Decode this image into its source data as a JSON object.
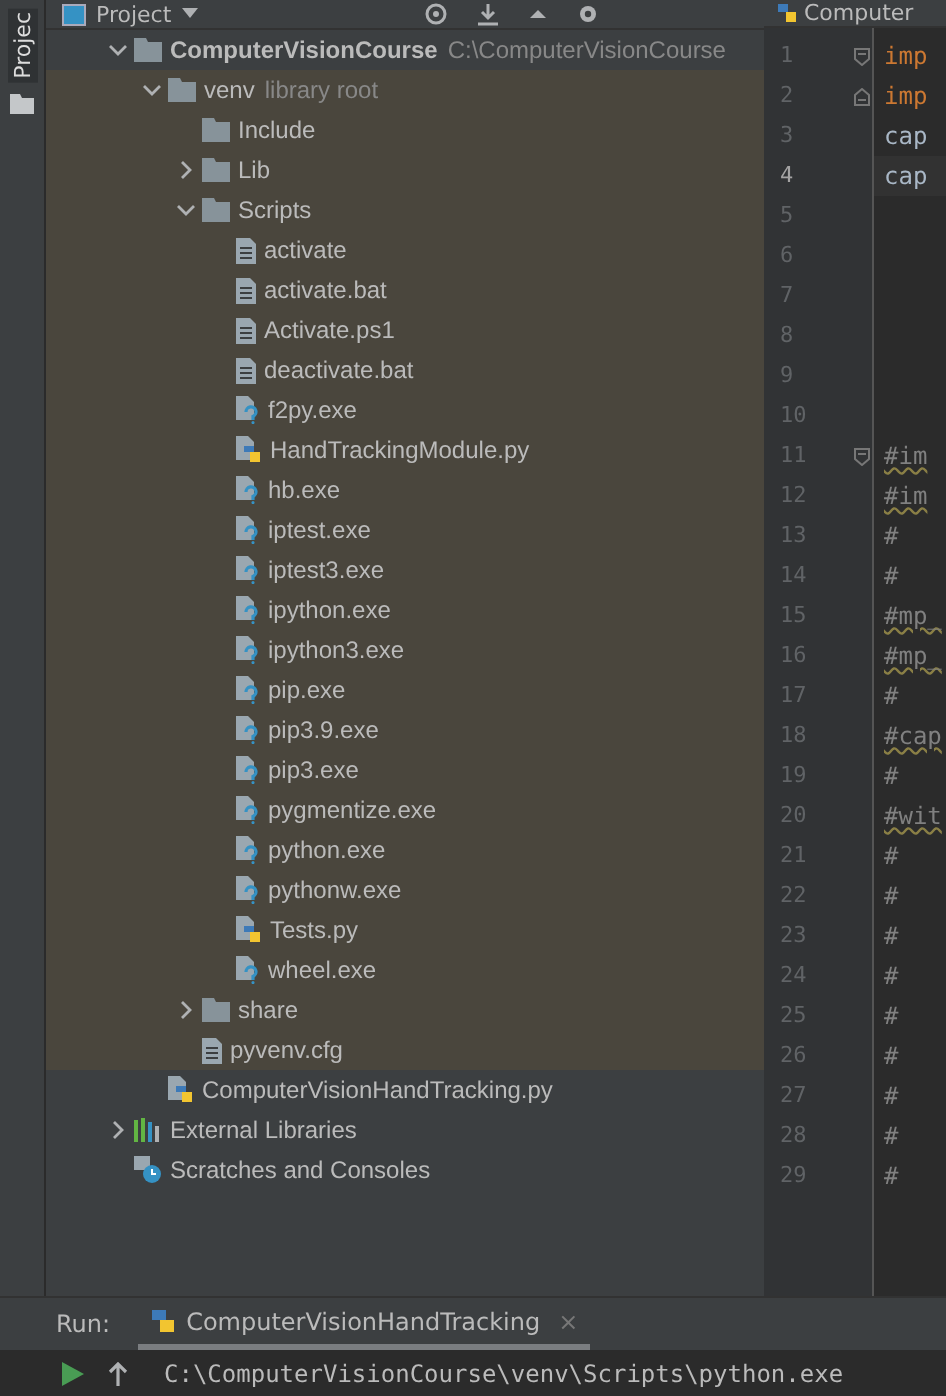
{
  "stripe": {
    "label": "Projec"
  },
  "project_header": {
    "title": "Project"
  },
  "tree": [
    {
      "name": "ComputerVisionCourse",
      "kind": "folder",
      "bold": true,
      "hint": "C:\\ComputerVisionCourse",
      "expanded": true,
      "children": [
        {
          "name": "venv",
          "kind": "folder",
          "hint": "library root",
          "library": true,
          "expanded": true,
          "children": [
            {
              "name": "Include",
              "kind": "folder"
            },
            {
              "name": "Lib",
              "kind": "folder",
              "expanded": false
            },
            {
              "name": "Scripts",
              "kind": "folder",
              "expanded": true,
              "children": [
                {
                  "name": "activate",
                  "kind": "text"
                },
                {
                  "name": "activate.bat",
                  "kind": "text"
                },
                {
                  "name": "Activate.ps1",
                  "kind": "text"
                },
                {
                  "name": "deactivate.bat",
                  "kind": "text"
                },
                {
                  "name": "f2py.exe",
                  "kind": "exe"
                },
                {
                  "name": "HandTrackingModule.py",
                  "kind": "python"
                },
                {
                  "name": "hb.exe",
                  "kind": "exe"
                },
                {
                  "name": "iptest.exe",
                  "kind": "exe"
                },
                {
                  "name": "iptest3.exe",
                  "kind": "exe"
                },
                {
                  "name": "ipython.exe",
                  "kind": "exe"
                },
                {
                  "name": "ipython3.exe",
                  "kind": "exe"
                },
                {
                  "name": "pip.exe",
                  "kind": "exe"
                },
                {
                  "name": "pip3.9.exe",
                  "kind": "exe"
                },
                {
                  "name": "pip3.exe",
                  "kind": "exe"
                },
                {
                  "name": "pygmentize.exe",
                  "kind": "exe"
                },
                {
                  "name": "python.exe",
                  "kind": "exe"
                },
                {
                  "name": "pythonw.exe",
                  "kind": "exe"
                },
                {
                  "name": "Tests.py",
                  "kind": "python"
                },
                {
                  "name": "wheel.exe",
                  "kind": "exe"
                }
              ]
            },
            {
              "name": "share",
              "kind": "folder",
              "expanded": false
            },
            {
              "name": "pyvenv.cfg",
              "kind": "text"
            }
          ]
        },
        {
          "name": "ComputerVisionHandTracking.py",
          "kind": "python"
        }
      ]
    },
    {
      "name": "External Libraries",
      "kind": "libraries",
      "expanded": false
    },
    {
      "name": "Scratches and Consoles",
      "kind": "scratches"
    }
  ],
  "editor": {
    "tab": "Computer",
    "lines": [
      {
        "number": "1",
        "code": "imp",
        "kind": "keyword",
        "fold_start": true,
        "current": false,
        "warning": false
      },
      {
        "number": "2",
        "code": "imp",
        "kind": "keyword",
        "fold_end": true,
        "current": false,
        "warning": false
      },
      {
        "number": "3",
        "code": "cap",
        "kind": "plain",
        "current": false,
        "warning": false
      },
      {
        "number": "4",
        "code": "cap",
        "kind": "plain",
        "current": true,
        "warning": false
      },
      {
        "number": "5",
        "current": false
      },
      {
        "number": "6",
        "current": false
      },
      {
        "number": "7",
        "current": false
      },
      {
        "number": "8",
        "current": false
      },
      {
        "number": "9",
        "current": false
      },
      {
        "number": "10",
        "current": false
      },
      {
        "number": "11",
        "code": "#im",
        "kind": "comment",
        "fold_start": true,
        "current": false,
        "warning": true
      },
      {
        "number": "12",
        "code": "#im",
        "kind": "comment",
        "current": false,
        "warning": true
      },
      {
        "number": "13",
        "code": "#",
        "kind": "comment",
        "current": false,
        "warning": false
      },
      {
        "number": "14",
        "code": "#",
        "kind": "comment",
        "current": false,
        "warning": false
      },
      {
        "number": "15",
        "code": "#mp_",
        "kind": "comment",
        "current": false,
        "warning": true
      },
      {
        "number": "16",
        "code": "#mp_",
        "kind": "comment",
        "current": false,
        "warning": true
      },
      {
        "number": "17",
        "code": "#",
        "kind": "comment",
        "current": false,
        "warning": false
      },
      {
        "number": "18",
        "code": "#cap",
        "kind": "comment",
        "current": false,
        "warning": true
      },
      {
        "number": "19",
        "code": "#",
        "kind": "comment",
        "current": false,
        "warning": false
      },
      {
        "number": "20",
        "code": "#wit",
        "kind": "comment",
        "current": false,
        "warning": true
      },
      {
        "number": "21",
        "code": "#",
        "kind": "comment",
        "current": false,
        "warning": false
      },
      {
        "number": "22",
        "code": "#",
        "kind": "comment",
        "current": false,
        "warning": false
      },
      {
        "number": "23",
        "code": "#",
        "kind": "comment",
        "current": false,
        "warning": false
      },
      {
        "number": "24",
        "code": "#",
        "kind": "comment",
        "current": false,
        "warning": false
      },
      {
        "number": "25",
        "code": "#",
        "kind": "comment",
        "current": false,
        "warning": false
      },
      {
        "number": "26",
        "code": "#",
        "kind": "comment",
        "current": false,
        "warning": false
      },
      {
        "number": "27",
        "code": "#",
        "kind": "comment",
        "current": false,
        "warning": false
      },
      {
        "number": "28",
        "code": "#",
        "kind": "comment",
        "current": false,
        "warning": false
      },
      {
        "number": "29",
        "code": "#",
        "kind": "comment",
        "current": false,
        "warning": false
      }
    ]
  },
  "run": {
    "label": "Run:",
    "tab": "ComputerVisionHandTracking",
    "close": "×",
    "output": "C:\\ComputerVisionCourse\\venv\\Scripts\\python.exe"
  }
}
